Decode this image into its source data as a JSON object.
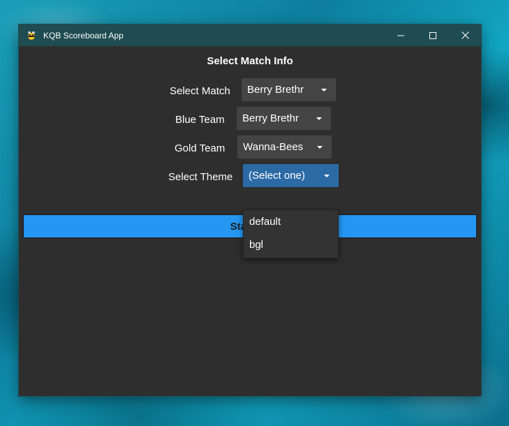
{
  "window": {
    "title": "KQB Scoreboard App",
    "icon": "bee-icon"
  },
  "form": {
    "heading": "Select Match Info",
    "fields": {
      "match": {
        "label": "Select Match",
        "value": "Berry Brethr"
      },
      "blue_team": {
        "label": "Blue Team",
        "value": "Berry Brethr"
      },
      "gold_team": {
        "label": "Gold Team",
        "value": "Wanna-Bees"
      },
      "theme": {
        "label": "Select Theme",
        "value": "(Select one)"
      }
    },
    "start_button_label": "Start Sc",
    "theme_options": [
      "default",
      "bgl"
    ]
  },
  "colors": {
    "titlebar": "#1f4c52",
    "window_bg": "#2e2e2e",
    "accent": "#2597f3",
    "combo_active": "#2c6aa6"
  }
}
